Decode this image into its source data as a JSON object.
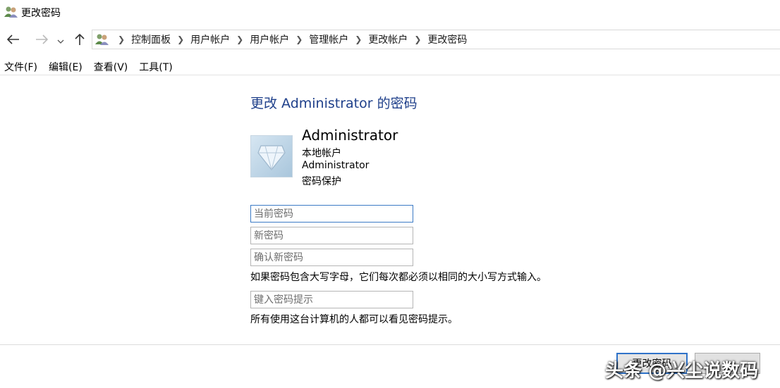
{
  "window": {
    "title": "更改密码"
  },
  "address_bar": {
    "crumbs": [
      "控制面板",
      "用户帐户",
      "用户帐户",
      "管理帐户",
      "更改帐户",
      "更改密码"
    ]
  },
  "menu": {
    "items": [
      "文件(F)",
      "编辑(E)",
      "查看(V)",
      "工具(T)"
    ]
  },
  "main": {
    "heading": "更改 Administrator 的密码",
    "account": {
      "name": "Administrator",
      "type": "本地帐户",
      "group": "Administrator",
      "protection": "密码保护"
    },
    "fields": {
      "current_password_placeholder": "当前密码",
      "new_password_placeholder": "新密码",
      "confirm_password_placeholder": "确认新密码",
      "hint_placeholder": "键入密码提示"
    },
    "case_note": "如果密码包含大写字母，它们每次都必须以相同的大小写方式输入。",
    "hint_note": "所有使用这台计算机的人都可以看见密码提示。"
  },
  "buttons": {
    "primary_label": "更改密码",
    "cancel_label": ""
  },
  "watermark": "头条 @兴尘说数码",
  "colors": {
    "heading": "#1e3f8a",
    "focus_border": "#3b7ac5",
    "primary_border": "#2f73c9"
  }
}
